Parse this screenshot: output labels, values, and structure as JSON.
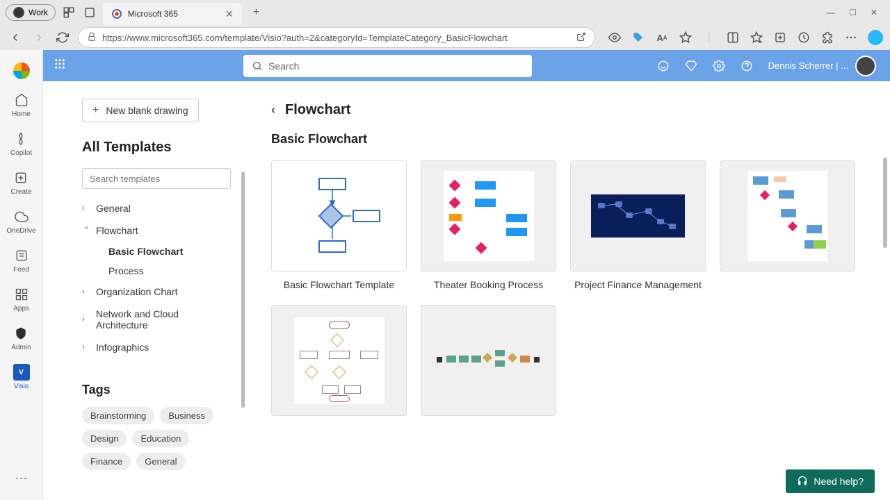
{
  "browser": {
    "work_label": "Work",
    "tab_title": "Microsoft 365",
    "url": "https://www.microsoft365.com/template/Visio?auth=2&categoryId=TemplateCategory_BasicFlowchart",
    "window_min": "—",
    "window_max": "☐",
    "window_close": "✕"
  },
  "header": {
    "search_placeholder": "Search",
    "user_name": "Dennis Scherrer | ..."
  },
  "rail": {
    "items": [
      {
        "label": "Home"
      },
      {
        "label": "Copilot"
      },
      {
        "label": "Create"
      },
      {
        "label": "OneDrive"
      },
      {
        "label": "Feed"
      },
      {
        "label": "Apps"
      },
      {
        "label": "Admin"
      },
      {
        "label": "Visio"
      }
    ]
  },
  "sidebar": {
    "new_blank": "New blank drawing",
    "all_templates": "All Templates",
    "search_placeholder": "Search templates",
    "tree": {
      "general": "General",
      "flowchart": "Flowchart",
      "basic_flowchart": "Basic Flowchart",
      "process": "Process",
      "org_chart": "Organization Chart",
      "network": "Network and Cloud Architecture",
      "infographics": "Infographics"
    },
    "tags_title": "Tags",
    "tags": [
      "Brainstorming",
      "Business",
      "Design",
      "Education",
      "Finance",
      "General"
    ]
  },
  "content": {
    "breadcrumb": "Flowchart",
    "section": "Basic Flowchart",
    "templates": [
      {
        "label": "Basic Flowchart Template"
      },
      {
        "label": "Theater Booking Process"
      },
      {
        "label": "Project Finance Management"
      },
      {
        "label": ""
      },
      {
        "label": ""
      },
      {
        "label": ""
      }
    ]
  },
  "need_help": "Need help?"
}
